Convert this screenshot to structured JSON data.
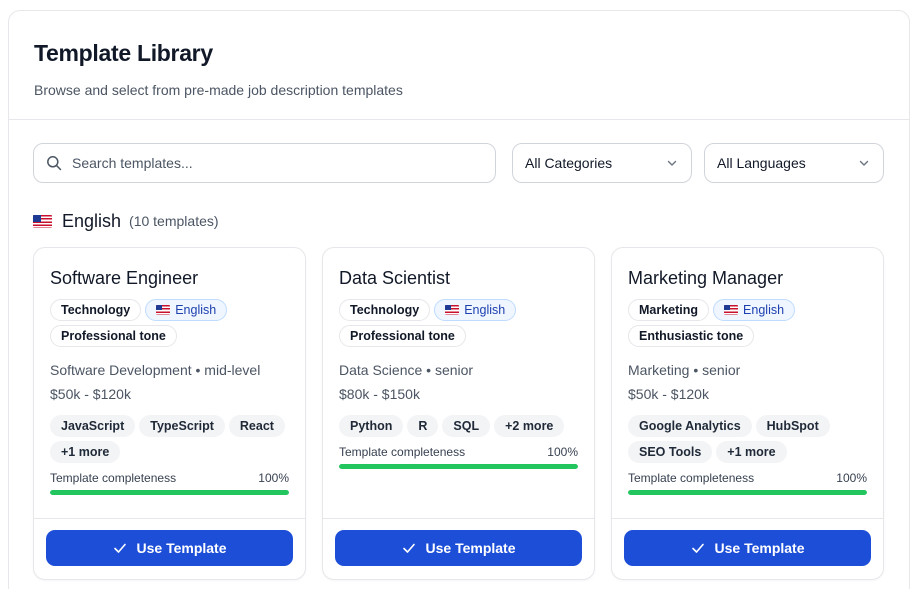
{
  "header": {
    "title": "Template Library",
    "subtitle": "Browse and select from pre-made job description templates"
  },
  "filters": {
    "search_placeholder": "Search templates...",
    "category_selected": "All Categories",
    "language_selected": "All Languages"
  },
  "group": {
    "flag_icon": "us-flag-icon",
    "name": "English",
    "count_text": "(10 templates)"
  },
  "colors": {
    "primary": "#1d4ed8",
    "progress": "#22c55e",
    "language_tag_bg": "#eff6ff"
  },
  "cards": [
    {
      "title": "Software Engineer",
      "category": "Technology",
      "language": "English",
      "tone": "Professional tone",
      "meta": "Software Development • mid-level",
      "salary": "$50k - $120k",
      "skills": [
        "JavaScript",
        "TypeScript",
        "React",
        "+1 more"
      ],
      "completeness_label": "Template completeness",
      "completeness_text": "100%",
      "completeness": 1.0,
      "button_label": "Use Template"
    },
    {
      "title": "Data Scientist",
      "category": "Technology",
      "language": "English",
      "tone": "Professional tone",
      "meta": "Data Science • senior",
      "salary": "$80k - $150k",
      "skills": [
        "Python",
        "R",
        "SQL",
        "+2 more"
      ],
      "completeness_label": "Template completeness",
      "completeness_text": "100%",
      "completeness": 1.0,
      "button_label": "Use Template"
    },
    {
      "title": "Marketing Manager",
      "category": "Marketing",
      "language": "English",
      "tone": "Enthusiastic tone",
      "meta": "Marketing • senior",
      "salary": "$50k - $120k",
      "skills": [
        "Google Analytics",
        "HubSpot",
        "SEO Tools",
        "+1 more"
      ],
      "completeness_label": "Template completeness",
      "completeness_text": "100%",
      "completeness": 1.0,
      "button_label": "Use Template"
    }
  ]
}
